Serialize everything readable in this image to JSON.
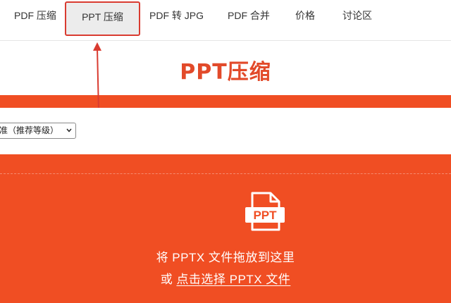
{
  "nav": {
    "items": [
      {
        "label": "PDF 压缩"
      },
      {
        "label": "PPT 压缩",
        "active": true
      },
      {
        "label": "PDF 转 JPG"
      },
      {
        "label": "PDF 合并"
      },
      {
        "label": "价格"
      },
      {
        "label": "讨论区"
      }
    ]
  },
  "page": {
    "title": "PPT压缩"
  },
  "options": {
    "compression_level_selected": "准（推荐等级）"
  },
  "dropzone": {
    "icon_label": "PPT",
    "line1": "将 PPTX 文件拖放到这里",
    "or_text": "或",
    "link_text": "点击选择 PPTX 文件"
  },
  "colors": {
    "accent": "#f04e23",
    "title": "#e24a2a",
    "annotation": "#d93b30"
  },
  "icons": [
    "arrow-annotation-icon",
    "file-ppt-icon",
    "chevron-down-icon"
  ]
}
